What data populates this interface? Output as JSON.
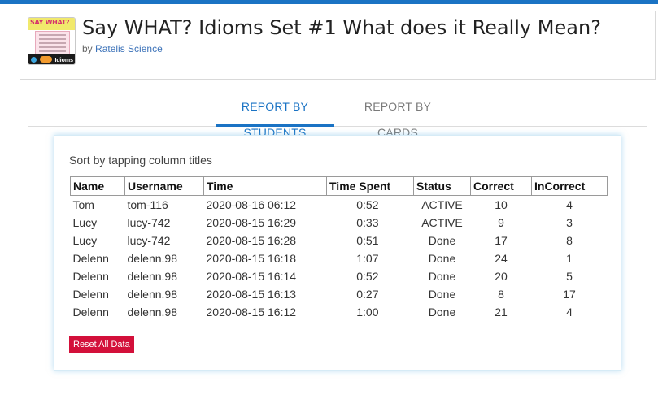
{
  "deck": {
    "title": "Say WHAT? Idioms Set #1 What does it Really Mean?",
    "by_prefix": "by",
    "author": "Ratelis Science",
    "thumbnail": {
      "title": "SAY WHAT?",
      "label": "Idioms"
    }
  },
  "tabs": [
    {
      "label": "REPORT BY STUDENTS",
      "active": true
    },
    {
      "label": "REPORT BY CARDS",
      "active": false
    }
  ],
  "report": {
    "sort_hint": "Sort by tapping column titles",
    "columns": [
      "Name",
      "Username",
      "Time",
      "Time Spent",
      "Status",
      "Correct",
      "InCorrect"
    ],
    "rows": [
      {
        "name": "Tom",
        "username": "tom-116",
        "time": "2020-08-16 06:12",
        "time_spent": "0:52",
        "status": "ACTIVE",
        "correct": "10",
        "incorrect": "4"
      },
      {
        "name": "Lucy",
        "username": "lucy-742",
        "time": "2020-08-15 16:29",
        "time_spent": "0:33",
        "status": "ACTIVE",
        "correct": "9",
        "incorrect": "3"
      },
      {
        "name": "Lucy",
        "username": "lucy-742",
        "time": "2020-08-15 16:28",
        "time_spent": "0:51",
        "status": "Done",
        "correct": "17",
        "incorrect": "8"
      },
      {
        "name": "Delenn",
        "username": "delenn.98",
        "time": "2020-08-15 16:18",
        "time_spent": "1:07",
        "status": "Done",
        "correct": "24",
        "incorrect": "1"
      },
      {
        "name": "Delenn",
        "username": "delenn.98",
        "time": "2020-08-15 16:14",
        "time_spent": "0:52",
        "status": "Done",
        "correct": "20",
        "incorrect": "5"
      },
      {
        "name": "Delenn",
        "username": "delenn.98",
        "time": "2020-08-15 16:13",
        "time_spent": "0:27",
        "status": "Done",
        "correct": "8",
        "incorrect": "17"
      },
      {
        "name": "Delenn",
        "username": "delenn.98",
        "time": "2020-08-15 16:12",
        "time_spent": "1:00",
        "status": "Done",
        "correct": "21",
        "incorrect": "4"
      }
    ],
    "reset_label": "Reset All Data"
  },
  "colors": {
    "accent": "#1a73c4",
    "reset": "#d3103a"
  }
}
